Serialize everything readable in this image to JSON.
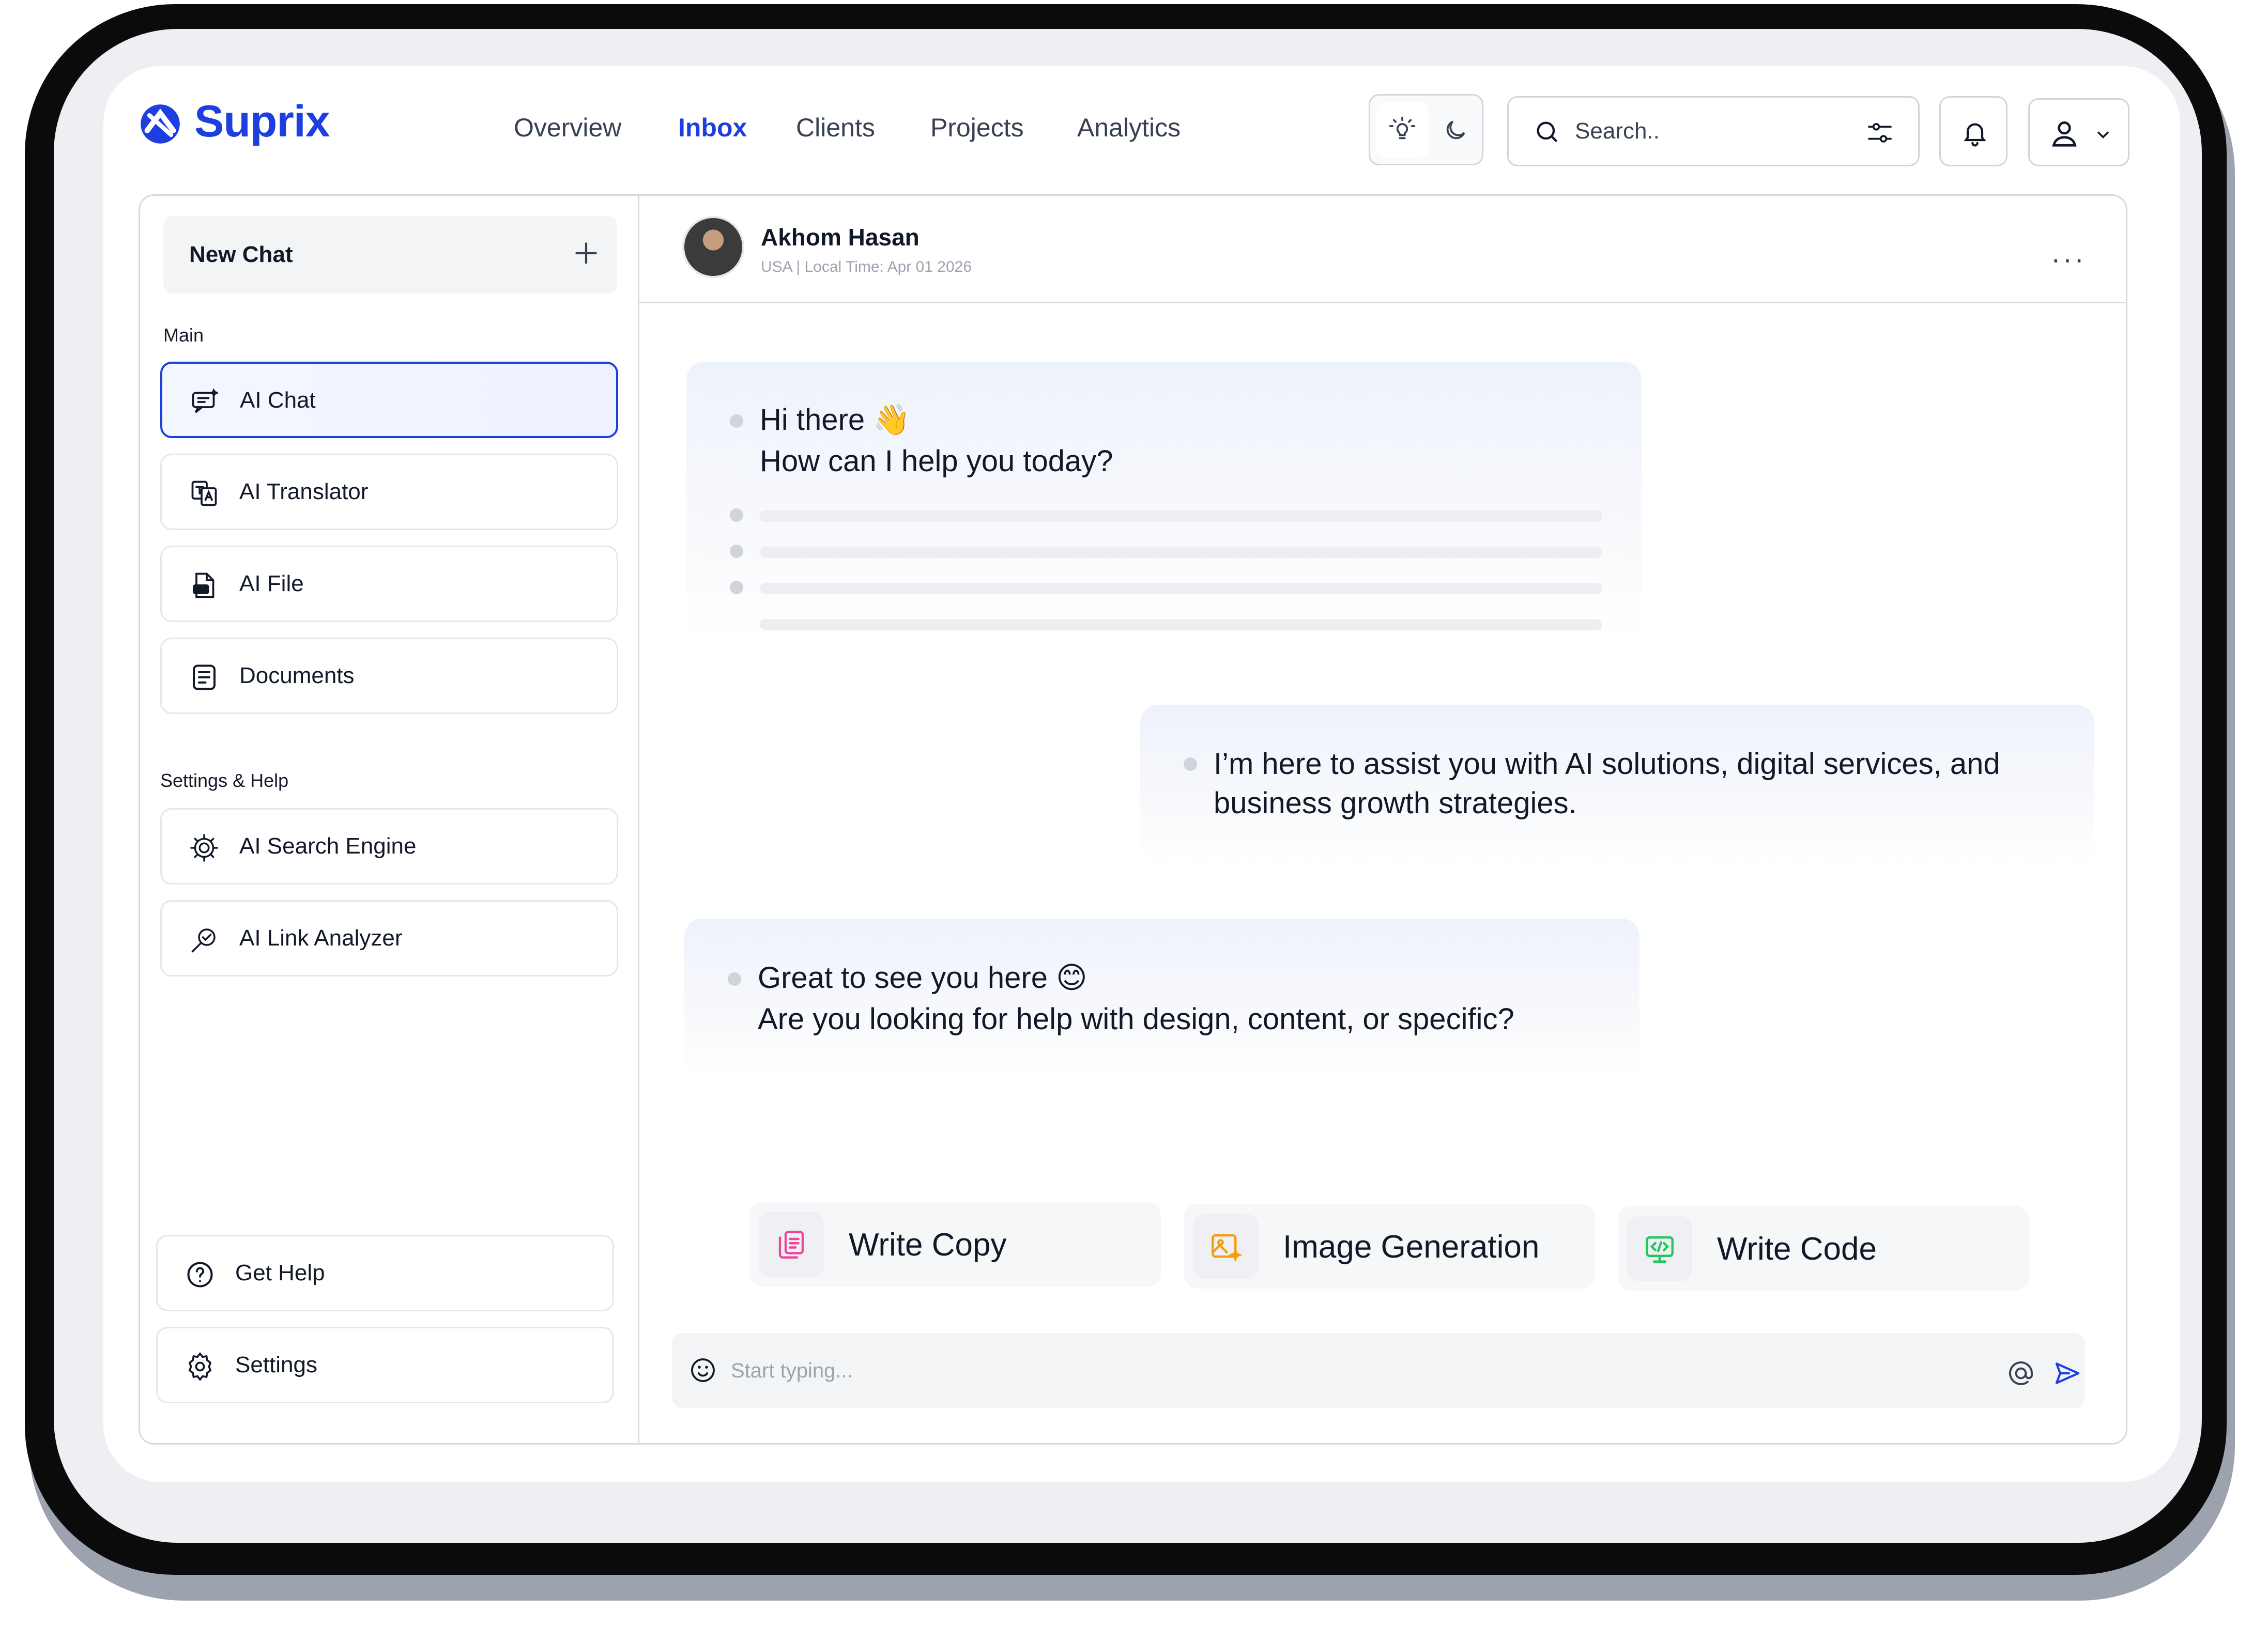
{
  "brand": {
    "name": "Suprix",
    "color": "#1d3fe0"
  },
  "nav": {
    "items": [
      {
        "label": "Overview"
      },
      {
        "label": "Inbox",
        "active": true
      },
      {
        "label": "Clients"
      },
      {
        "label": "Projects"
      },
      {
        "label": "Analytics"
      }
    ]
  },
  "header": {
    "theme_icons": [
      "sun-icon",
      "moon-icon"
    ],
    "search_placeholder": "Search..",
    "icons": [
      "search-icon",
      "filter-icon",
      "bell-icon",
      "user-icon",
      "chevron-down-icon"
    ]
  },
  "sidebar": {
    "new_chat_label": "New Chat",
    "main_label": "Main",
    "main_items": [
      {
        "label": "AI Chat",
        "icon": "chat-icon",
        "active": true
      },
      {
        "label": "AI Translator",
        "icon": "translate-icon"
      },
      {
        "label": "AI File",
        "icon": "ai-file-icon"
      },
      {
        "label": "Documents",
        "icon": "document-icon"
      }
    ],
    "settings_label": "Settings & Help",
    "settings_items": [
      {
        "label": "AI Search Engine",
        "icon": "gear-network-icon"
      },
      {
        "label": "AI Link Analyzer",
        "icon": "link-analyzer-icon"
      }
    ],
    "bottom_items": [
      {
        "label": "Get Help",
        "icon": "help-icon"
      },
      {
        "label": "Settings",
        "icon": "settings-icon"
      }
    ]
  },
  "chat": {
    "contact_name": "Akhom Hasan",
    "contact_meta": "USA | Local Time: Apr 01 2026",
    "messages": [
      {
        "line1": "Hi there 👋",
        "line2": "How can I help you today?"
      },
      {
        "line1": "I’m here to assist you with AI solutions, digital services, and",
        "line2": "business growth strategies."
      },
      {
        "line1": "Great to see you here 😊",
        "line2": "Are you looking for help with design, content, or specific?"
      }
    ],
    "quick_actions": [
      {
        "label": "Write Copy",
        "icon": "copy-icon",
        "color": "#ec4899"
      },
      {
        "label": "Image Generation",
        "icon": "image-icon",
        "color": "#f59e0b"
      },
      {
        "label": "Write Code",
        "icon": "code-icon",
        "color": "#22c55e"
      }
    ],
    "composer_placeholder": "Start typing...",
    "composer_icons": [
      "emoji-icon",
      "at-icon",
      "send-icon"
    ]
  }
}
